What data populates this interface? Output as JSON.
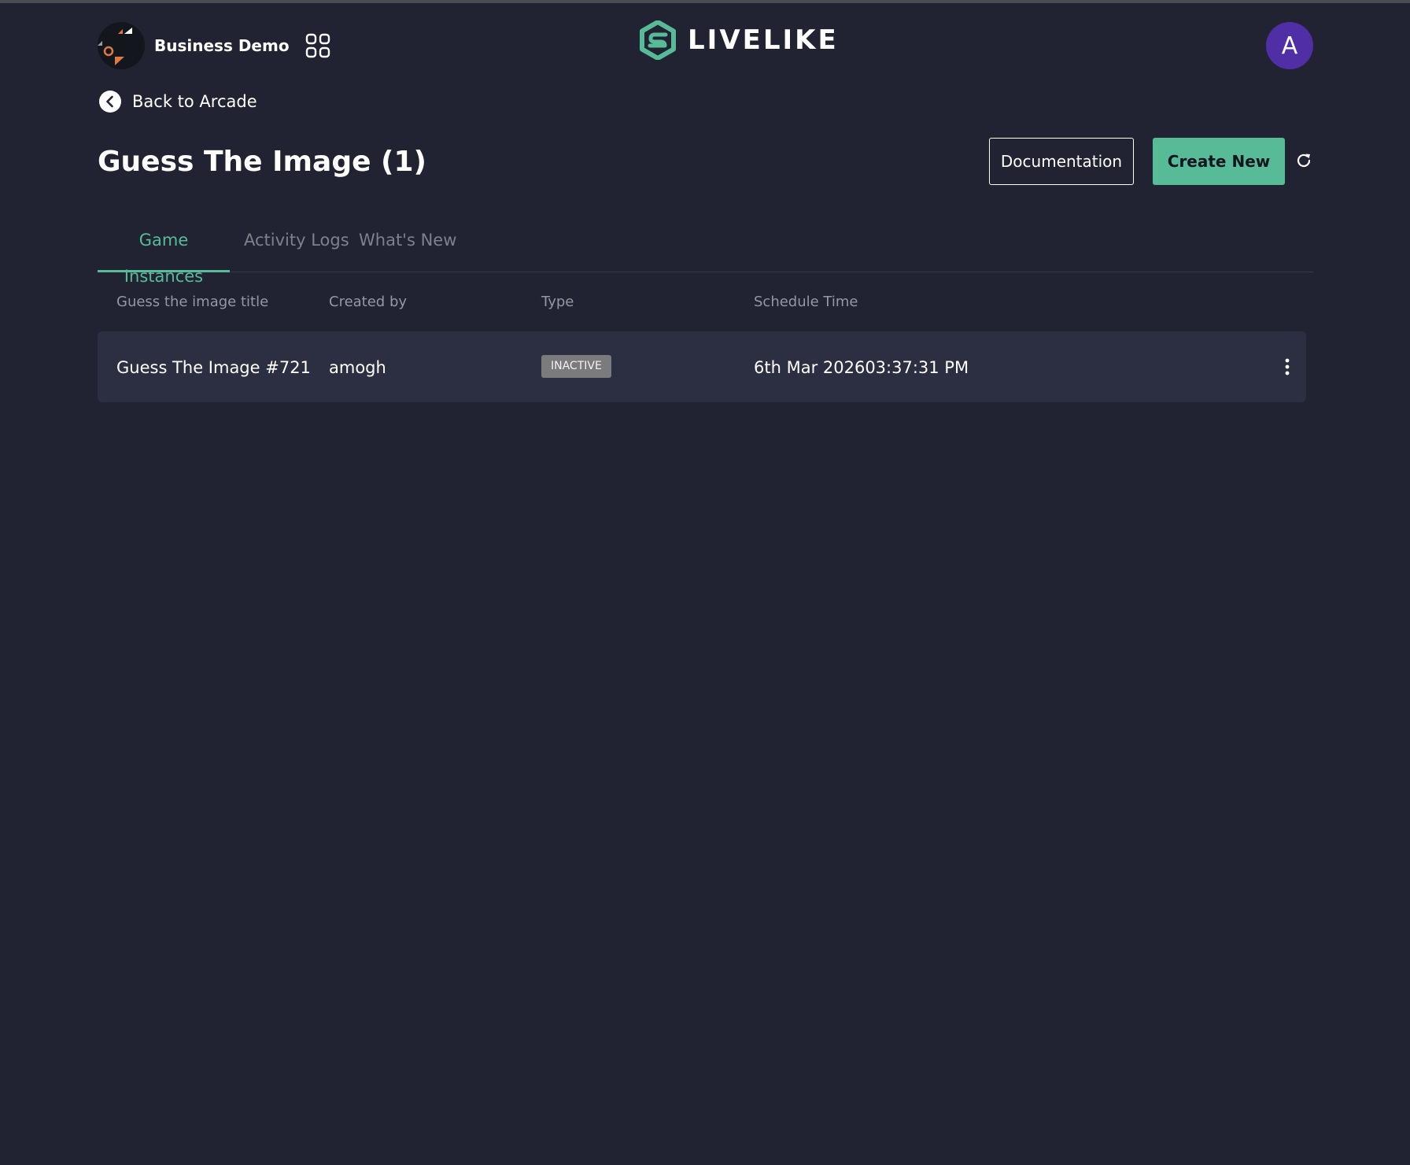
{
  "header": {
    "org_name": "Business Demo",
    "org_avatar_icon": "org-logo-icon",
    "apps_icon": "grid-apps-icon",
    "brand_name": "LIVELIKE",
    "brand_color": "#57bb98",
    "user_initial": "A",
    "user_avatar_color": "#4f2ea6"
  },
  "nav": {
    "back_label": "Back to Arcade",
    "back_icon": "chevron-left-circle-icon"
  },
  "page": {
    "title": "Guess The Image (1)"
  },
  "actions": {
    "documentation_label": "Documentation",
    "create_label": "Create New",
    "refresh_icon": "refresh-icon"
  },
  "tabs": [
    {
      "label": "Game Instances",
      "active": true
    },
    {
      "label": "Activity Logs",
      "active": false
    },
    {
      "label": "What's New",
      "active": false
    }
  ],
  "table": {
    "columns": [
      "Guess the image title",
      "Created by",
      "Type",
      "Schedule Time"
    ],
    "rows": [
      {
        "title": "Guess The Image #721",
        "created_by": "amogh",
        "type": "INACTIVE",
        "schedule_time": "6th Mar 202603:37:31 PM",
        "menu_icon": "more-vertical-icon"
      }
    ]
  },
  "colors": {
    "background": "#212332",
    "row_background": "#2c2f41",
    "accent": "#57bb98",
    "badge_inactive": "#7b7b7d"
  }
}
